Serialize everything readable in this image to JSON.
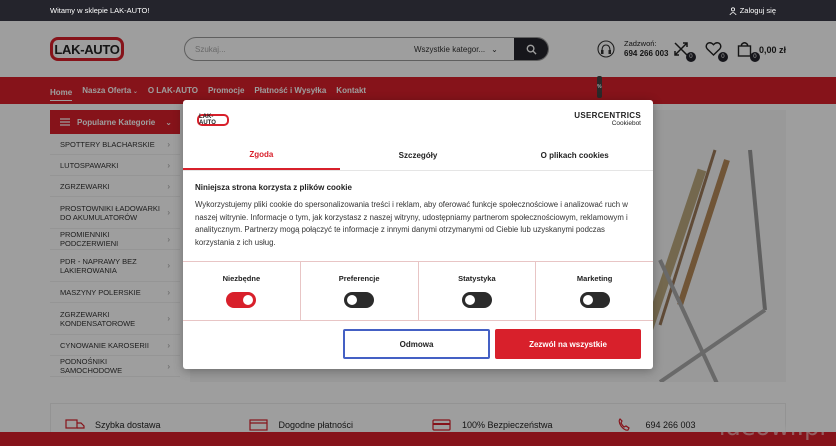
{
  "topbar": {
    "welcome": "Witamy w sklepie LAK-AUTO!",
    "login": "Zaloguj się"
  },
  "header": {
    "logo": "LAK-AUTO",
    "search_placeholder": "Szukaj...",
    "category_select": "Wszystkie kategor...",
    "contact_label": "Zadzwoń:",
    "contact_phone": "694 266 003",
    "compare_count": "0",
    "wishlist_count": "0",
    "cart_count": "0",
    "cart_total": "0,00 zł"
  },
  "nav": {
    "items": [
      "Home",
      "Nasza Oferta",
      "O LAK-AUTO",
      "Promocje",
      "Płatność i Wysyłka",
      "Kontakt"
    ],
    "promo_badge": "%"
  },
  "sidebar": {
    "title": "Popularne Kategorie",
    "items": [
      "SPOTTERY BLACHARSKIE",
      "LUTOSPAWARKI",
      "ZGRZEWARKI",
      "PROSTOWNIKI ŁADOWARKI DO AKUMULATORÓW",
      "PROMIENNIKI PODCZERWIENI",
      "PDR - NAPRAWY BEZ LAKIEROWANIA",
      "MASZYNY POLERSKIE",
      "ZGRZEWARKI KONDENSATOROWE",
      "CYNOWANIE KAROSERII",
      "PODNOŚNIKI SAMOCHODOWE"
    ]
  },
  "features": {
    "items": [
      "Szybka dostawa",
      "Dogodne płatności",
      "100% Bezpieczeństwa",
      "694 266 003"
    ]
  },
  "watermark": "ideowi.pl",
  "cookie": {
    "logo": "LAK-AUTO",
    "brand": "USERCENTRICS",
    "brand_sub": "Cookiebot",
    "tabs": [
      "Zgoda",
      "Szczegóły",
      "O plikach cookies"
    ],
    "title": "Niniejsza strona korzysta z plików cookie",
    "text": "Wykorzystujemy pliki cookie do spersonalizowania treści i reklam, aby oferować funkcje społecznościowe i analizować ruch w naszej witrynie. Informacje o tym, jak korzystasz z naszej witryny, udostępniamy partnerom społecznościowym, reklamowym i analitycznym. Partnerzy mogą połączyć te informacje z innymi danymi otrzymanymi od Ciebie lub uzyskanymi podczas korzystania z ich usług.",
    "toggles": [
      {
        "label": "Niezbędne",
        "on": true
      },
      {
        "label": "Preferencje",
        "on": false
      },
      {
        "label": "Statystyka",
        "on": false
      },
      {
        "label": "Marketing",
        "on": false
      }
    ],
    "btn_deny": "Odmowa",
    "btn_accept": "Zezwól na wszystkie"
  },
  "colors": {
    "accent": "#d8202b",
    "dark": "#24242c"
  }
}
